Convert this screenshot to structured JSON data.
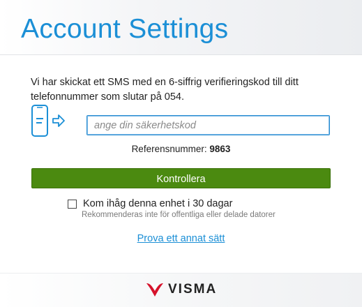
{
  "header": {
    "title": "Account Settings"
  },
  "verification": {
    "message": "Vi har skickat ett SMS med en 6-siffrig verifieringskod till ditt telefonnummer som slutar på 054.",
    "code_placeholder": "ange din säkerhetskod",
    "code_value": "",
    "reference_label": "Referensnummer:",
    "reference_number": "9863",
    "submit_label": "Kontrollera"
  },
  "remember": {
    "label": "Kom ihåg denna enhet i 30 dagar",
    "checked": false,
    "note": "Rekommenderas inte för offentliga eller delade datorer"
  },
  "alt_method_link": "Prova ett annat sätt",
  "footer": {
    "brand": "VISMA"
  },
  "colors": {
    "title_blue": "#1b8fd6",
    "button_green": "#4b8a10",
    "logo_red": "#d6122b"
  },
  "icons": [
    "phone-sms-icon",
    "arrow-right-icon",
    "checkbox-icon",
    "visma-logo-icon"
  ]
}
